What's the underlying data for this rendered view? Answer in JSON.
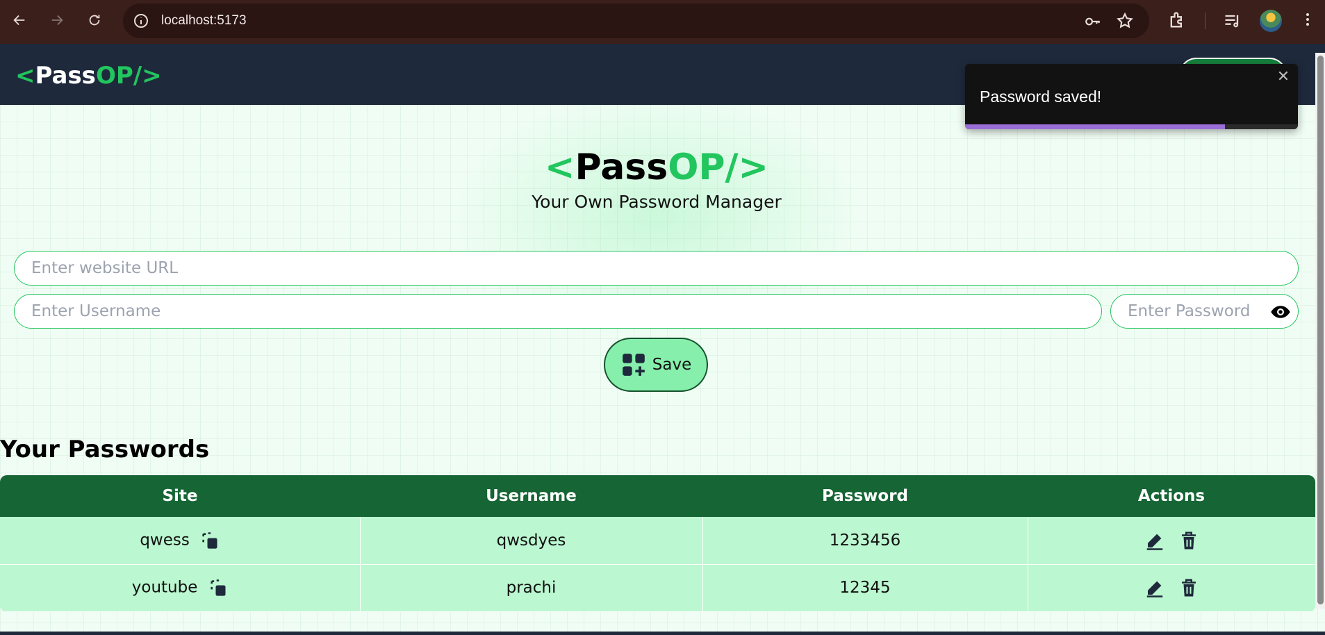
{
  "browser": {
    "url": "localhost:5173",
    "icons": [
      "back-icon",
      "forward-icon",
      "reload-icon",
      "site-info-icon",
      "password-key-icon",
      "bookmark-star-icon",
      "extensions-icon",
      "media-control-icon",
      "profile-avatar",
      "more-menu-icon"
    ]
  },
  "navbar": {
    "logo": {
      "open": "<",
      "pass": "Pass",
      "op": "OP/>"
    }
  },
  "hero": {
    "logo": {
      "open": "<",
      "pass": "Pass",
      "op": "OP/>"
    },
    "subtitle": "Your Own Password Manager"
  },
  "form": {
    "url_placeholder": "Enter website URL",
    "username_placeholder": "Enter Username",
    "password_placeholder": "Enter Password",
    "save_label": "Save"
  },
  "passwords": {
    "title": "Your Passwords",
    "columns": [
      "Site",
      "Username",
      "Password",
      "Actions"
    ],
    "rows": [
      {
        "site": "qwess",
        "username": "qwsdyes",
        "password": "1233456"
      },
      {
        "site": "youtube",
        "username": "prachi",
        "password": "12345"
      }
    ]
  },
  "toast": {
    "message": "Password saved!",
    "close": "✕",
    "progress": 0.78
  },
  "colors": {
    "accent_green": "#22c55e",
    "table_header": "#166534",
    "row_bg": "#bbf7d0",
    "navbar_bg": "#1e293b",
    "toast_progress": "#9b6dd6"
  }
}
